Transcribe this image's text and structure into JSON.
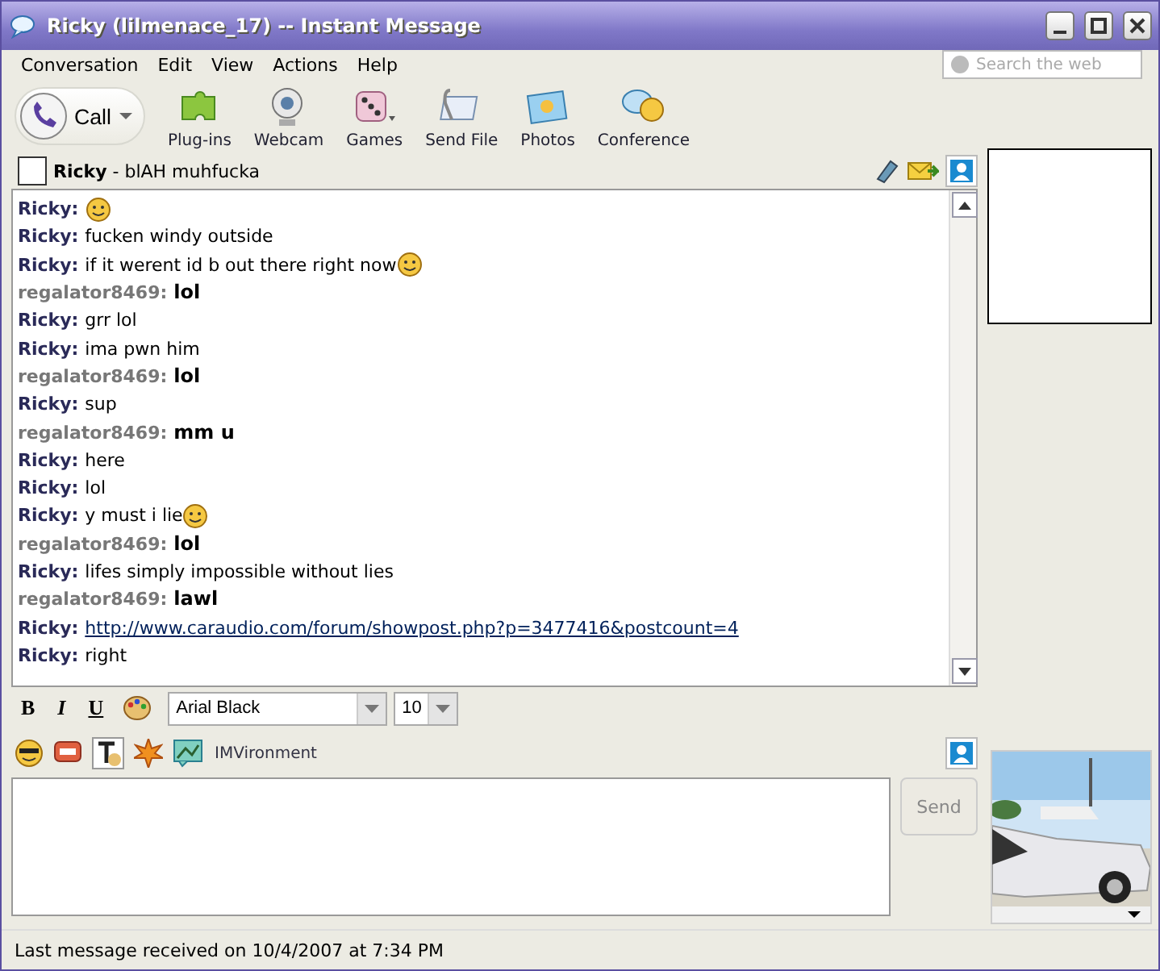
{
  "window": {
    "title": "Ricky (lilmenace_17) -- Instant Message"
  },
  "menu": [
    "Conversation",
    "Edit",
    "View",
    "Actions",
    "Help"
  ],
  "search": {
    "placeholder": "Search the web"
  },
  "toolbar": [
    {
      "kind": "call",
      "label": "Call"
    },
    {
      "kind": "plugins",
      "label": "Plug-ins"
    },
    {
      "kind": "webcam",
      "label": "Webcam"
    },
    {
      "kind": "games",
      "label": "Games"
    },
    {
      "kind": "sendfile",
      "label": "Send File"
    },
    {
      "kind": "photos",
      "label": "Photos"
    },
    {
      "kind": "conference",
      "label": "Conference"
    }
  ],
  "contact": {
    "name": "Ricky",
    "status": " - blAH muhfucka"
  },
  "messages": [
    {
      "sender": "Ricky:",
      "kind": "buddy",
      "emoticon": true
    },
    {
      "sender": "Ricky:",
      "kind": "buddy",
      "text": "fucken windy outside"
    },
    {
      "sender": "Ricky:",
      "kind": "buddy",
      "text": "if it werent id b out there right now",
      "emoticon": true
    },
    {
      "sender": "regalator8469:",
      "kind": "self",
      "text": "lol"
    },
    {
      "sender": "Ricky:",
      "kind": "buddy",
      "text": "grr lol"
    },
    {
      "sender": "Ricky:",
      "kind": "buddy",
      "text": "ima pwn him"
    },
    {
      "sender": "regalator8469:",
      "kind": "self",
      "text": "lol"
    },
    {
      "sender": "Ricky:",
      "kind": "buddy",
      "text": "sup"
    },
    {
      "sender": "regalator8469:",
      "kind": "self",
      "text": "mm u"
    },
    {
      "sender": "Ricky:",
      "kind": "buddy",
      "text": "here"
    },
    {
      "sender": "Ricky:",
      "kind": "buddy",
      "text": "lol"
    },
    {
      "sender": "Ricky:",
      "kind": "buddy",
      "text": "y must i lie",
      "emoticon": true
    },
    {
      "sender": "regalator8469:",
      "kind": "self",
      "text": "lol"
    },
    {
      "sender": "Ricky:",
      "kind": "buddy",
      "text": "lifes simply impossible without lies"
    },
    {
      "sender": "regalator8469:",
      "kind": "self",
      "text": "lawl"
    },
    {
      "sender": "Ricky:",
      "kind": "buddy",
      "link": "http://www.caraudio.com/forum/showpost.php?p=3477416&postcount=4"
    },
    {
      "sender": "Ricky:",
      "kind": "buddy",
      "text": "right"
    }
  ],
  "format": {
    "bold": "B",
    "italic": "I",
    "underline": "U",
    "font": "Arial Black",
    "size": "10"
  },
  "imvironment": {
    "label": "IMVironment"
  },
  "send": {
    "label": "Send",
    "disabled": true
  },
  "status_bar": "Last message received on 10/4/2007 at 7:34 PM"
}
